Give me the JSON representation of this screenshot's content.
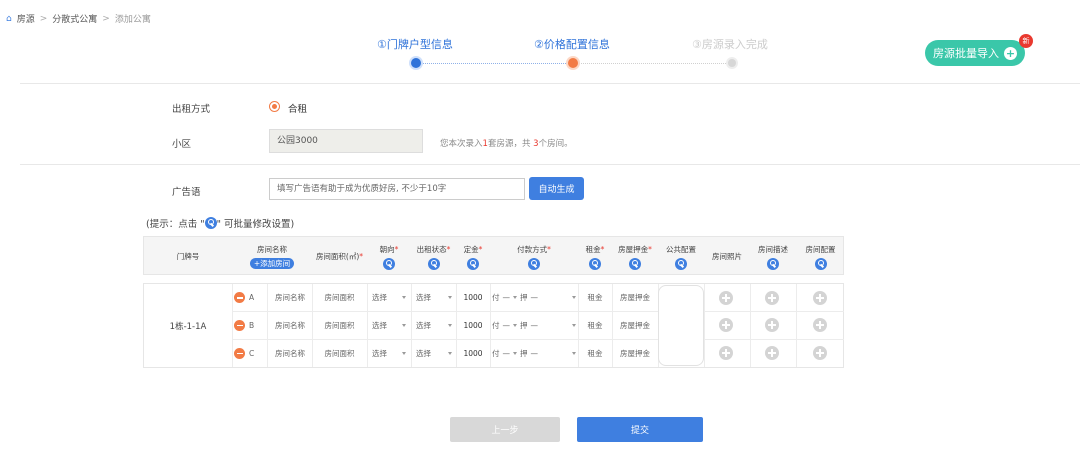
{
  "breadcrumb": {
    "home": "房源",
    "level2": "分散式公寓",
    "current": "添加公寓",
    "sep": ">"
  },
  "steps": [
    {
      "label": "①门牌户型信息",
      "state": "done"
    },
    {
      "label": "②价格配置信息",
      "state": "current"
    },
    {
      "label": "③房源录入完成",
      "state": "todo"
    }
  ],
  "batch_import": {
    "label": "房源批量导入",
    "badge": "新"
  },
  "form": {
    "rent_mode_label": "出租方式",
    "rent_mode_value": "合租",
    "community_label": "小区",
    "community_value": "公园3000",
    "entry_note": {
      "prefix": "您本次录入",
      "houses": "1",
      "mid": "套房源，共 ",
      "rooms": "3",
      "suffix": "个房间。"
    },
    "ad_label": "广告语",
    "ad_placeholder": "填写广告语有助于成为优质好房, 不少于10字",
    "auto_generate": "自动生成"
  },
  "hint": {
    "prefix": "(提示：点击 \"",
    "suffix": "\" 可批量修改设置)"
  },
  "table": {
    "headers": {
      "door_no": "门牌号",
      "room_name": "房间名称",
      "add_room": "+添加房间",
      "area": "房间面积(㎡)",
      "orientation": "朝向",
      "rent_status": "出租状态",
      "rent_price": "定金",
      "payment": "付款方式",
      "rent": "租金",
      "deposit": "房屋押金",
      "public_config": "公共配置",
      "photos": "房间照片",
      "description": "房间描述",
      "room_config": "房间配置"
    },
    "door_no_value": "1栋-1-1A",
    "rooms": [
      {
        "letter": "A",
        "name": "房间名称",
        "area": "房间面积",
        "orientation": "选择",
        "status": "选择",
        "price": "1000",
        "pay1": "付",
        "pay2": "—",
        "pay3": "押",
        "pay4": "—",
        "rent": "租金",
        "deposit": "房屋押金"
      },
      {
        "letter": "B",
        "name": "房间名称",
        "area": "房间面积",
        "orientation": "选择",
        "status": "选择",
        "price": "1000",
        "pay1": "付",
        "pay2": "—",
        "pay3": "押",
        "pay4": "—",
        "rent": "租金",
        "deposit": "房屋押金"
      },
      {
        "letter": "C",
        "name": "房间名称",
        "area": "房间面积",
        "orientation": "选择",
        "status": "选择",
        "price": "1000",
        "pay1": "付",
        "pay2": "—",
        "pay3": "押",
        "pay4": "—",
        "rent": "租金",
        "deposit": "房屋押金"
      }
    ]
  },
  "buttons": {
    "prev": "上一步",
    "submit": "提交"
  },
  "colors": {
    "primary": "#3f7fe0",
    "accent": "#f27b45",
    "green": "#3ac7a9",
    "badge": "#e9392f"
  }
}
